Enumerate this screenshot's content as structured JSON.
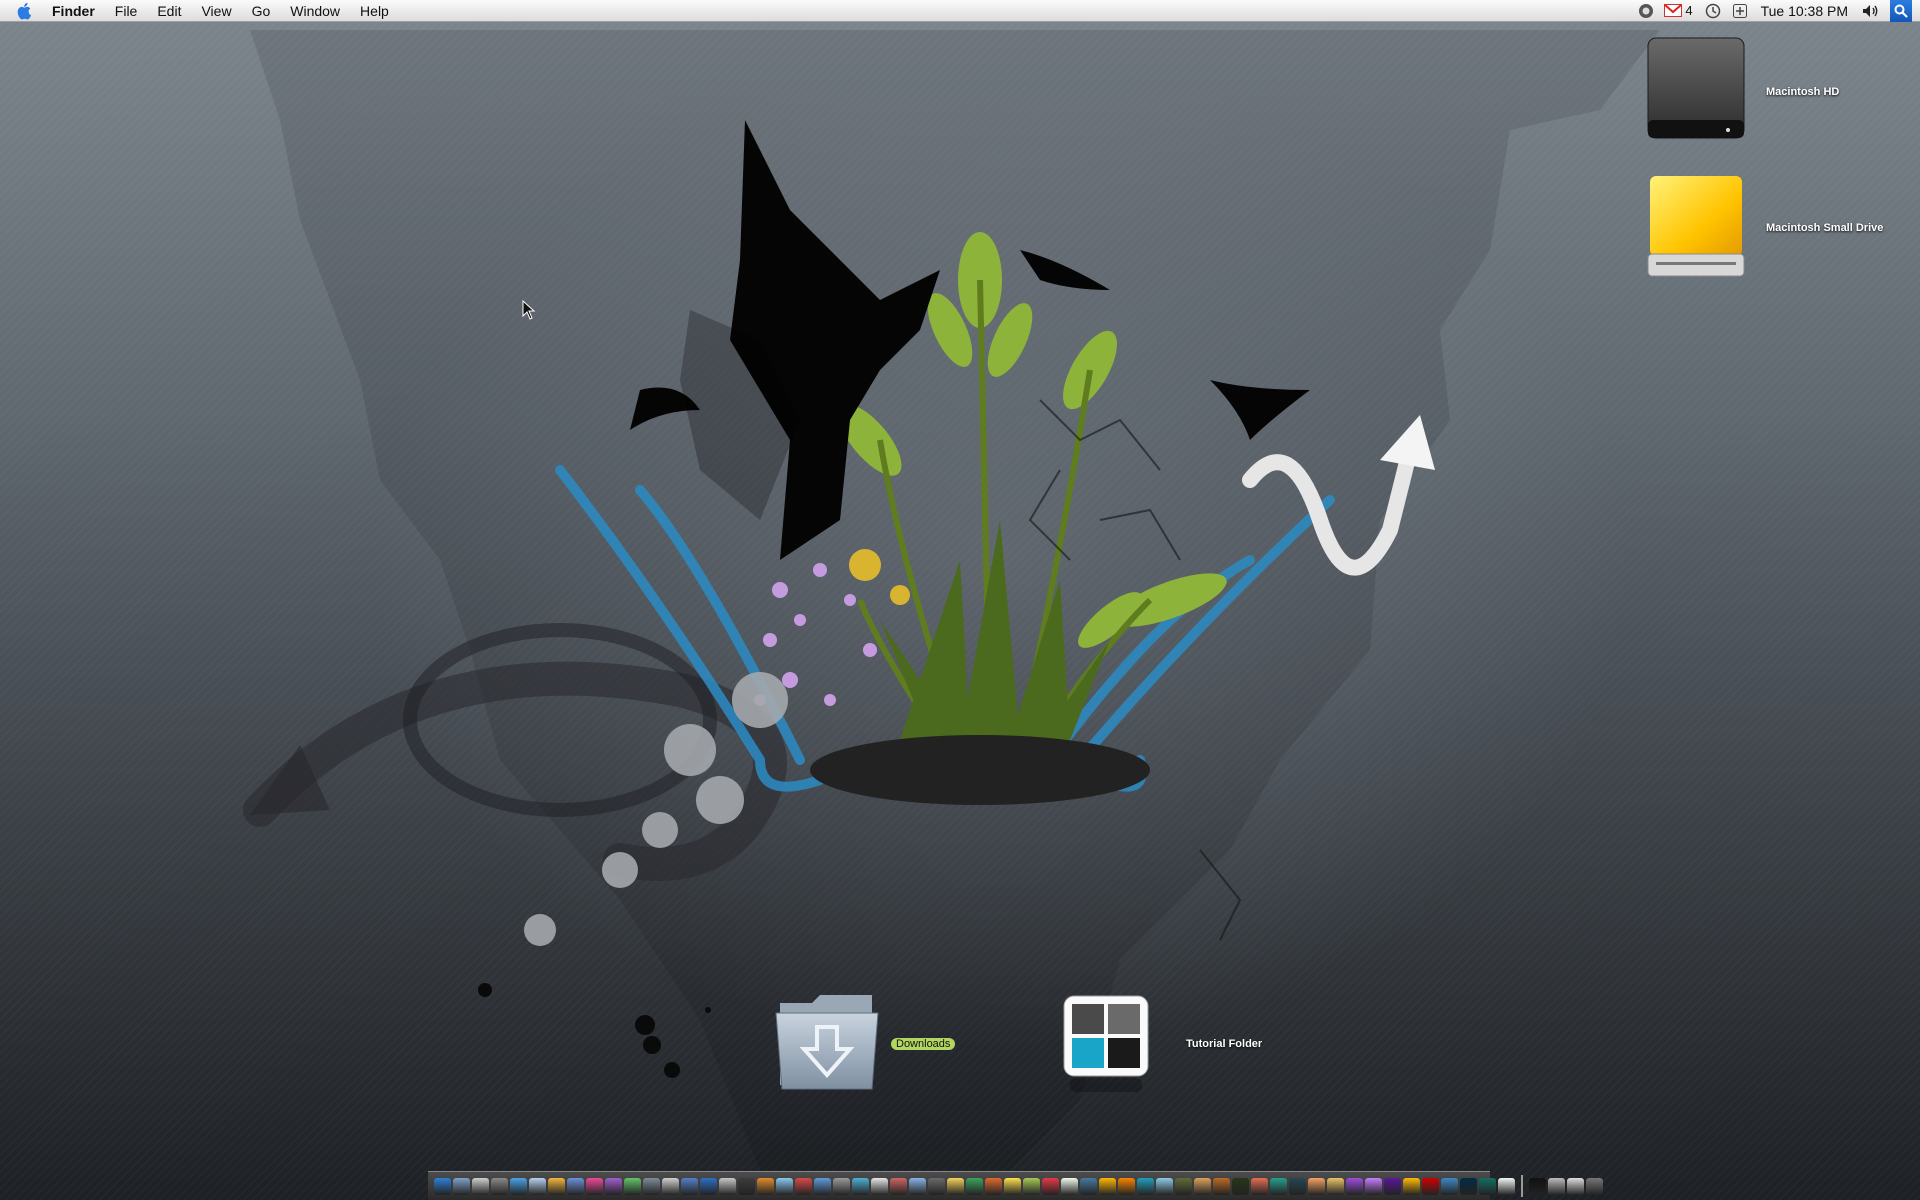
{
  "menubar": {
    "app_name": "Finder",
    "menus": [
      "File",
      "Edit",
      "View",
      "Go",
      "Window",
      "Help"
    ],
    "status": {
      "gmail_unread": "4",
      "clock": "Tue 10:38 PM",
      "icons": [
        "grab-icon",
        "gmail-icon",
        "timemachine-icon",
        "add-icon",
        "volume-icon",
        "spotlight-icon"
      ]
    }
  },
  "desktop": {
    "drives": [
      {
        "label": "Macintosh HD",
        "icon": "hard-drive-icon"
      },
      {
        "label": "Macintosh Small Drive",
        "icon": "external-drive-icon"
      }
    ],
    "items": [
      {
        "label": "Downloads",
        "icon": "downloads-folder-icon",
        "selected": true
      },
      {
        "label": "Tutorial Folder",
        "icon": "tutorial-folder-icon",
        "selected": false
      }
    ]
  },
  "dock": {
    "colors": [
      "#2f7fd8",
      "#7ea2c8",
      "#cfcfcf",
      "#8a8a8a",
      "#4aa3e8",
      "#b7d1ef",
      "#f2b640",
      "#6d91d9",
      "#ee4a9a",
      "#a05fcf",
      "#64c46a",
      "#7f8b99",
      "#d0d0d0",
      "#5580c6",
      "#2e6fc4",
      "#c7c7c7",
      "#3c3c3c",
      "#e28c2d",
      "#8dc8ef",
      "#d84a4a",
      "#5f9bd9",
      "#9b9b9b",
      "#4fb0d6",
      "#e6e6e6",
      "#cc6666",
      "#8ab3e6",
      "#6a6a6a",
      "#f4d35e",
      "#3da35d",
      "#e06b2f",
      "#ffe14d",
      "#a7c957",
      "#e63946",
      "#f1faee",
      "#457b9d",
      "#ffb703",
      "#fb8500",
      "#219ebc",
      "#8ecae6",
      "#606c38",
      "#dda15e",
      "#bc6c25",
      "#283618",
      "#e76f51",
      "#2a9d8f",
      "#264653",
      "#f4a261",
      "#e9c46a",
      "#9d4edd",
      "#c77dff",
      "#5a189a",
      "#ffba08",
      "#d00000",
      "#3f88c5",
      "#032b43",
      "#136f63",
      "#f5f5f5",
      "#111111",
      "#bbbbbb",
      "#dddddd",
      "#777777"
    ]
  }
}
